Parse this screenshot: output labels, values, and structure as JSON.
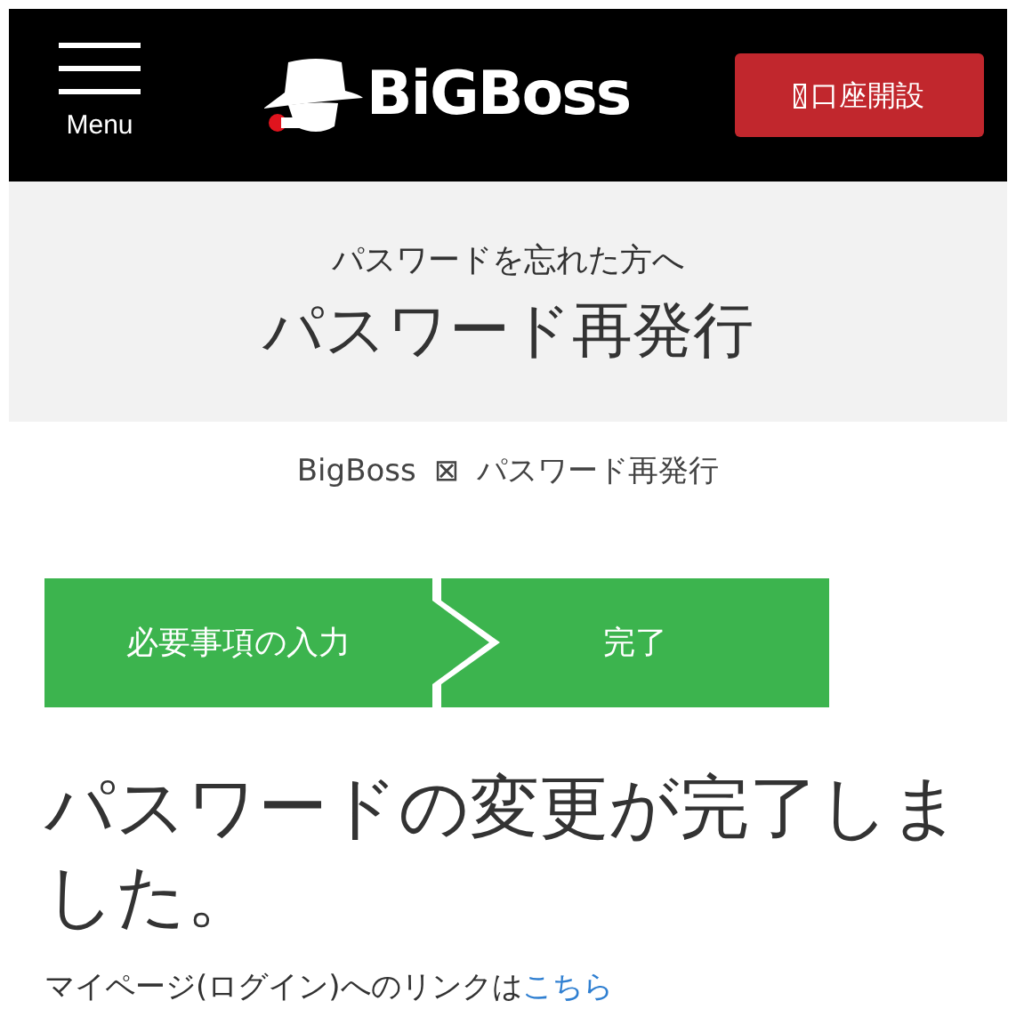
{
  "header": {
    "menu_label": "Menu",
    "logo_text": "BiGBoss",
    "open_account_button": "口座開設"
  },
  "page_banner": {
    "subtitle": "パスワードを忘れた方へ",
    "title": "パスワード再発行"
  },
  "breadcrumb": {
    "items": [
      "BigBoss",
      "パスワード再発行"
    ],
    "separator": "⊠"
  },
  "steps": [
    "必要事項の入力",
    "完了"
  ],
  "message": {
    "heading": "パスワードの変更が完了しました。",
    "text": "マイページ(ログイン)へのリンクは",
    "link": "こちら"
  }
}
